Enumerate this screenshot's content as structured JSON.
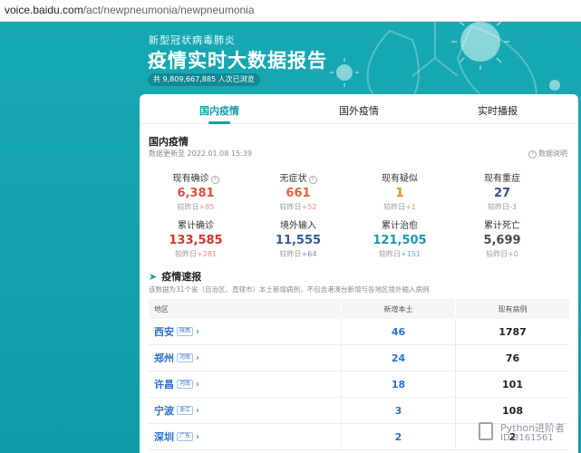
{
  "browser": {
    "url_host": "voice.baidu.com",
    "url_path": "/act/newpneumonia/newpneumonia"
  },
  "banner": {
    "subtitle": "新型冠状病毒肺炎",
    "title": "疫情实时大数据报告",
    "visit_count": "共 9,809,667,885 人次已浏览"
  },
  "tabs": [
    {
      "label": "国内疫情",
      "active": true
    },
    {
      "label": "国外疫情",
      "active": false
    },
    {
      "label": "实时播报",
      "active": false
    }
  ],
  "domestic": {
    "title": "国内疫情",
    "updated": "数据更新至 2022.01.08 15:39",
    "help": "数据说明",
    "stats": [
      {
        "label": "现有确诊",
        "has_help": true,
        "value": "6,381",
        "compare": "较昨日",
        "delta": "+85",
        "color": "#e44c3c",
        "delta_color": "#f08a7c"
      },
      {
        "label": "无症状",
        "has_help": true,
        "value": "661",
        "compare": "较昨日",
        "delta": "+52",
        "color": "#e8603c",
        "delta_color": "#f08a7c"
      },
      {
        "label": "现有疑似",
        "has_help": false,
        "value": "1",
        "compare": "较昨日",
        "delta": "+1",
        "color": "#ea8b1b",
        "delta_color": "#f0a14a"
      },
      {
        "label": "现有重症",
        "has_help": false,
        "value": "27",
        "compare": "较昨日",
        "delta": "-3",
        "color": "#3f4f8a",
        "delta_color": "#999999"
      },
      {
        "label": "累计确诊",
        "has_help": false,
        "value": "133,585",
        "compare": "较昨日",
        "delta": "+281",
        "color": "#d9332b",
        "delta_color": "#f08a7c"
      },
      {
        "label": "境外输入",
        "has_help": false,
        "value": "11,555",
        "compare": "较昨日",
        "delta": "+64",
        "color": "#2c5d96",
        "delta_color": "#6c8fbf"
      },
      {
        "label": "累计治愈",
        "has_help": false,
        "value": "121,505",
        "compare": "较昨日",
        "delta": "+151",
        "color": "#179ab0",
        "delta_color": "#5bb6c6"
      },
      {
        "label": "累计死亡",
        "has_help": false,
        "value": "5,699",
        "compare": "较昨日",
        "delta": "+0",
        "color": "#4a4a4a",
        "delta_color": "#999999"
      }
    ]
  },
  "speed": {
    "title": "疫情速报",
    "note": "该数据为31个省（自治区、直辖市）本土新增病例，不包含港澳台新增与各地区境外输入病例",
    "headers": {
      "region": "地区",
      "new_local": "新增本土",
      "existing": "现有病例"
    },
    "rows": [
      {
        "city": "西安",
        "province": "陕西",
        "new_local": "46",
        "existing": "1787"
      },
      {
        "city": "郑州",
        "province": "河南",
        "new_local": "24",
        "existing": "76"
      },
      {
        "city": "许昌",
        "province": "河南",
        "new_local": "18",
        "existing": "101"
      },
      {
        "city": "宁波",
        "province": "浙江",
        "new_local": "3",
        "existing": "108"
      },
      {
        "city": "深圳",
        "province": "广东",
        "new_local": "2",
        "existing": "2"
      }
    ]
  },
  "watermark": {
    "line1": "Python进阶者",
    "line2": "ID:8161561"
  },
  "colors": {
    "brand": "#16a0ab",
    "city_link": "#2b6fd1"
  }
}
